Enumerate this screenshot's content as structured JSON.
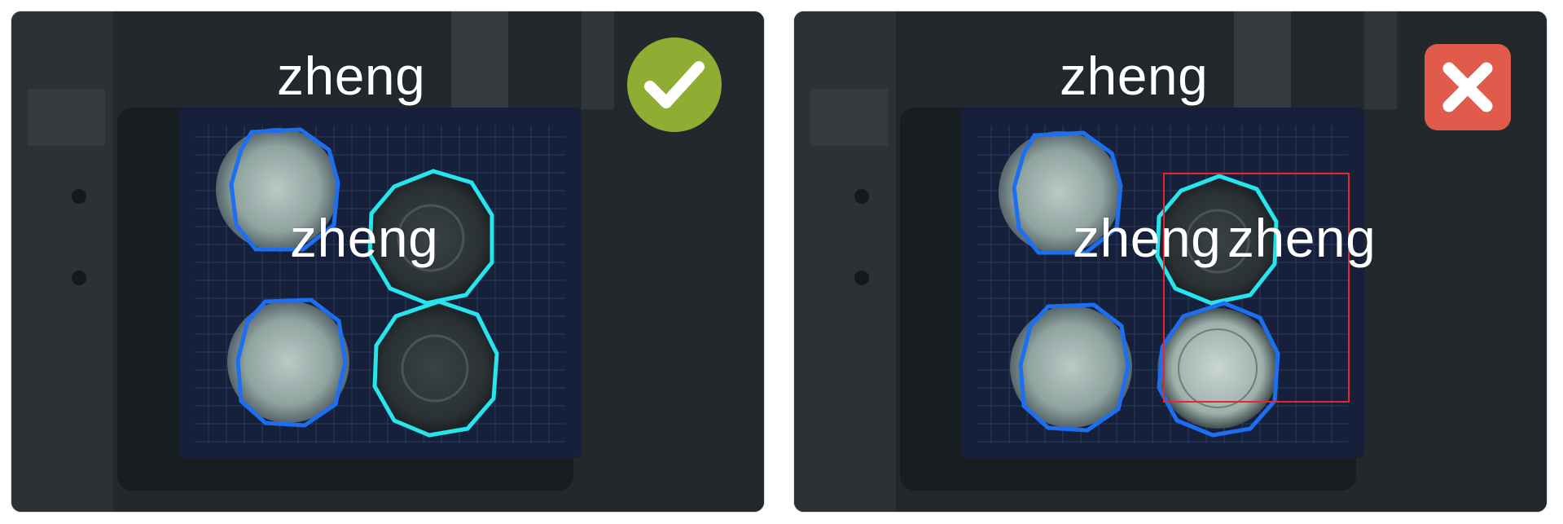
{
  "panels": [
    {
      "verdict": "correct",
      "labels": [
        "zheng",
        "zheng"
      ],
      "badge_icon": "checkmark-icon",
      "badge_color": "#8fac33"
    },
    {
      "verdict": "incorrect",
      "labels": [
        "zheng",
        "zheng",
        "zheng"
      ],
      "badge_icon": "cross-icon",
      "badge_color": "#e05b4b"
    }
  ],
  "colors": {
    "outline_blue": "#1d6ff2",
    "outline_cyan": "#27e5ec",
    "error_box_red": "#e6262f",
    "background_dark": "#20262b",
    "tray_blue": "#16203a"
  },
  "object_counts": {
    "left_panel": {
      "light_caps": 2,
      "dark_detectors": 2
    },
    "right_panel": {
      "light_caps": 3,
      "dark_detectors": 1
    }
  }
}
